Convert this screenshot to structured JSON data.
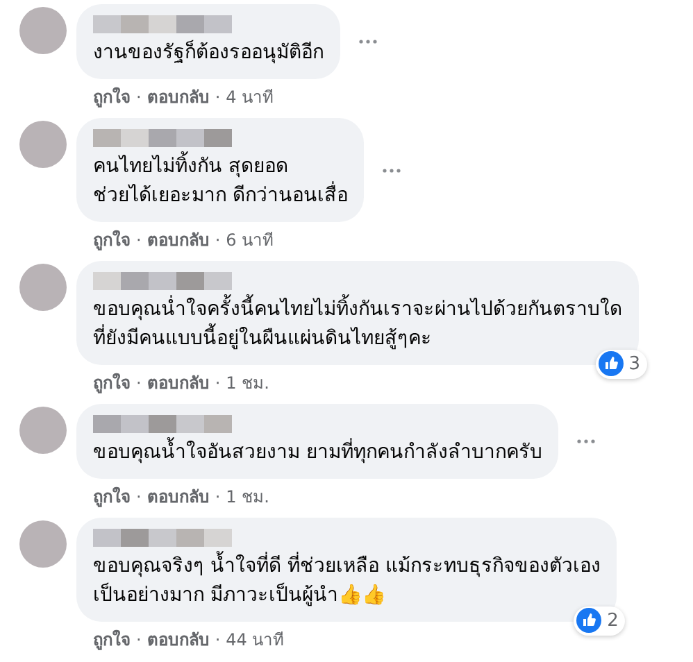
{
  "separator": "·",
  "comments": [
    {
      "text": "งานของรัฐก็ต้องรออนุมัติอีก",
      "like": "ถูกใจ",
      "reply": "ตอบกลับ",
      "time": "4 นาที",
      "menu_button": true
    },
    {
      "text": "คนไทยไม่ทิ้งกัน สุดยอด\nช่วยได้เยอะมาก ดีกว่านอนเสื่อ",
      "like": "ถูกใจ",
      "reply": "ตอบกลับ",
      "time": "6 นาที",
      "menu_button": true
    },
    {
      "text": "ขอบคุณน่ำใจครั้งนี้คนไทยไม่ทิ้งกันเราจะผ่านไปด้วยกันตราบใด\nที่ยังมีคนแบบนี้อยู่ในผืนแผ่นดินไทยสู้ๆคะ",
      "like": "ถูกใจ",
      "reply": "ตอบกลับ",
      "time": "1 ชม.",
      "menu_button": false,
      "reactions": "3"
    },
    {
      "text": "ขอบคุณน้ำใจอันสวยงาม ยามที่ทุกคนกำลังลำบากครับ",
      "like": "ถูกใจ",
      "reply": "ตอบกลับ",
      "time": "1 ชม.",
      "menu_button": true
    },
    {
      "text": "ขอบคุณจริงๆ น้ำใจที่ดี ที่ช่วยเหลือ แม้กระทบธุรกิจของตัวเอง\nเป็นอย่างมาก มีภาวะเป็นผู้นำ👍👍",
      "like": "ถูกใจ",
      "reply": "ตอบกลับ",
      "time": "44 นาที",
      "menu_button": false,
      "reactions": "2"
    }
  ]
}
